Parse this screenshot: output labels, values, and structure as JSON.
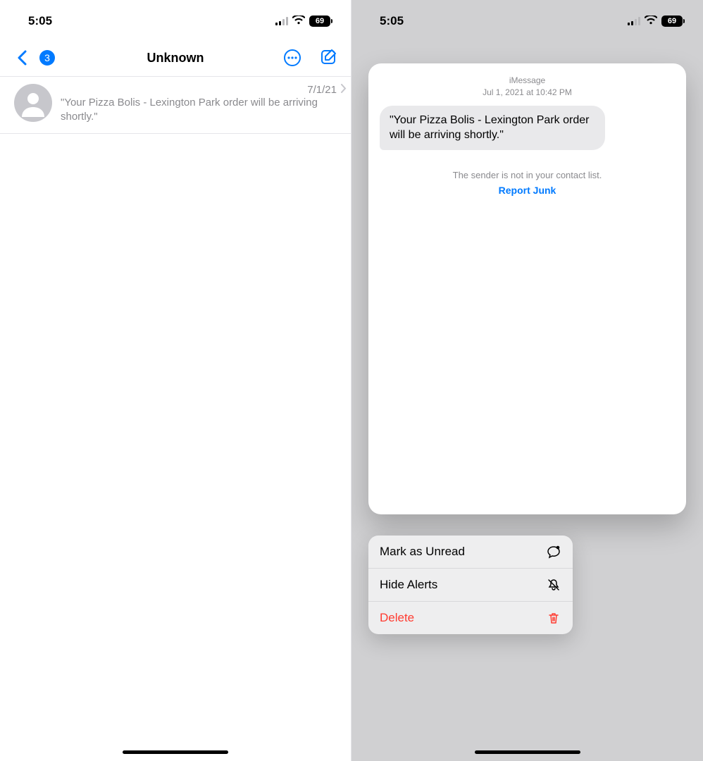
{
  "status": {
    "time": "5:05",
    "battery": "69"
  },
  "left": {
    "badge": "3",
    "title": "Unknown",
    "row": {
      "date": "7/1/21",
      "preview": "\"Your Pizza Bolis - Lexington Park order will be arriving shortly.\""
    }
  },
  "right": {
    "preview": {
      "service": "iMessage",
      "timestamp": "Jul 1, 2021 at 10:42 PM",
      "bubble": "\"Your Pizza Bolis - Lexington Park order will be arriving shortly.\"",
      "not_in_contacts": "The sender is not in your contact list.",
      "report_junk": "Report Junk"
    },
    "menu": {
      "mark_unread": "Mark as Unread",
      "hide_alerts": "Hide Alerts",
      "delete": "Delete"
    }
  }
}
